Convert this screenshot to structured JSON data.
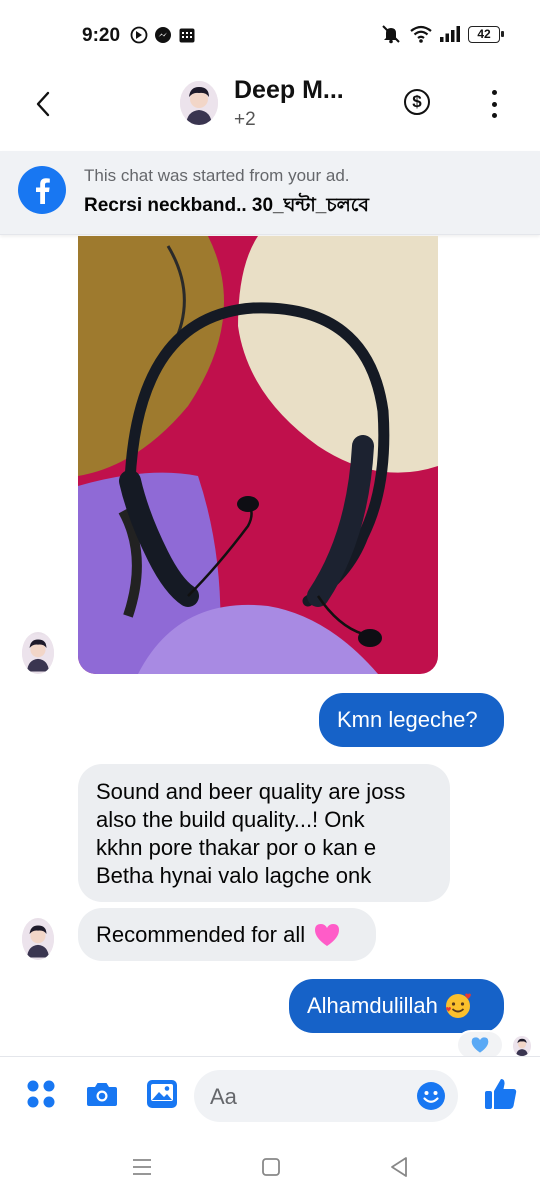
{
  "status_bar": {
    "time": "9:20",
    "battery": "42"
  },
  "header": {
    "title": "Deep M...",
    "subtitle": "+2"
  },
  "ad_banner": {
    "notice": "This chat was started from your ad.",
    "product": "Recrsi neckband.. 30_ঘন্টা_চলবে"
  },
  "messages": [
    {
      "direction": "out",
      "text": "Kmn legeche?"
    },
    {
      "direction": "in",
      "lines": [
        "Sound and beer quality are joss",
        "also the build quality...! Onk",
        "kkhn pore thakar por o kan e",
        "Betha hynai valo lagche onk"
      ]
    },
    {
      "direction": "in",
      "text": "Recommended for all",
      "emoji": "heart"
    },
    {
      "direction": "out",
      "text": "Alhamdulillah",
      "emoji": "smiling-face-with-hearts"
    }
  ],
  "reaction": {
    "icon": "blue-heart"
  },
  "composer": {
    "placeholder": "Aa"
  },
  "colors": {
    "brand_blue": "#1877f2",
    "outgoing_bubble": "#1662c8",
    "incoming_bubble": "#eceef1"
  }
}
